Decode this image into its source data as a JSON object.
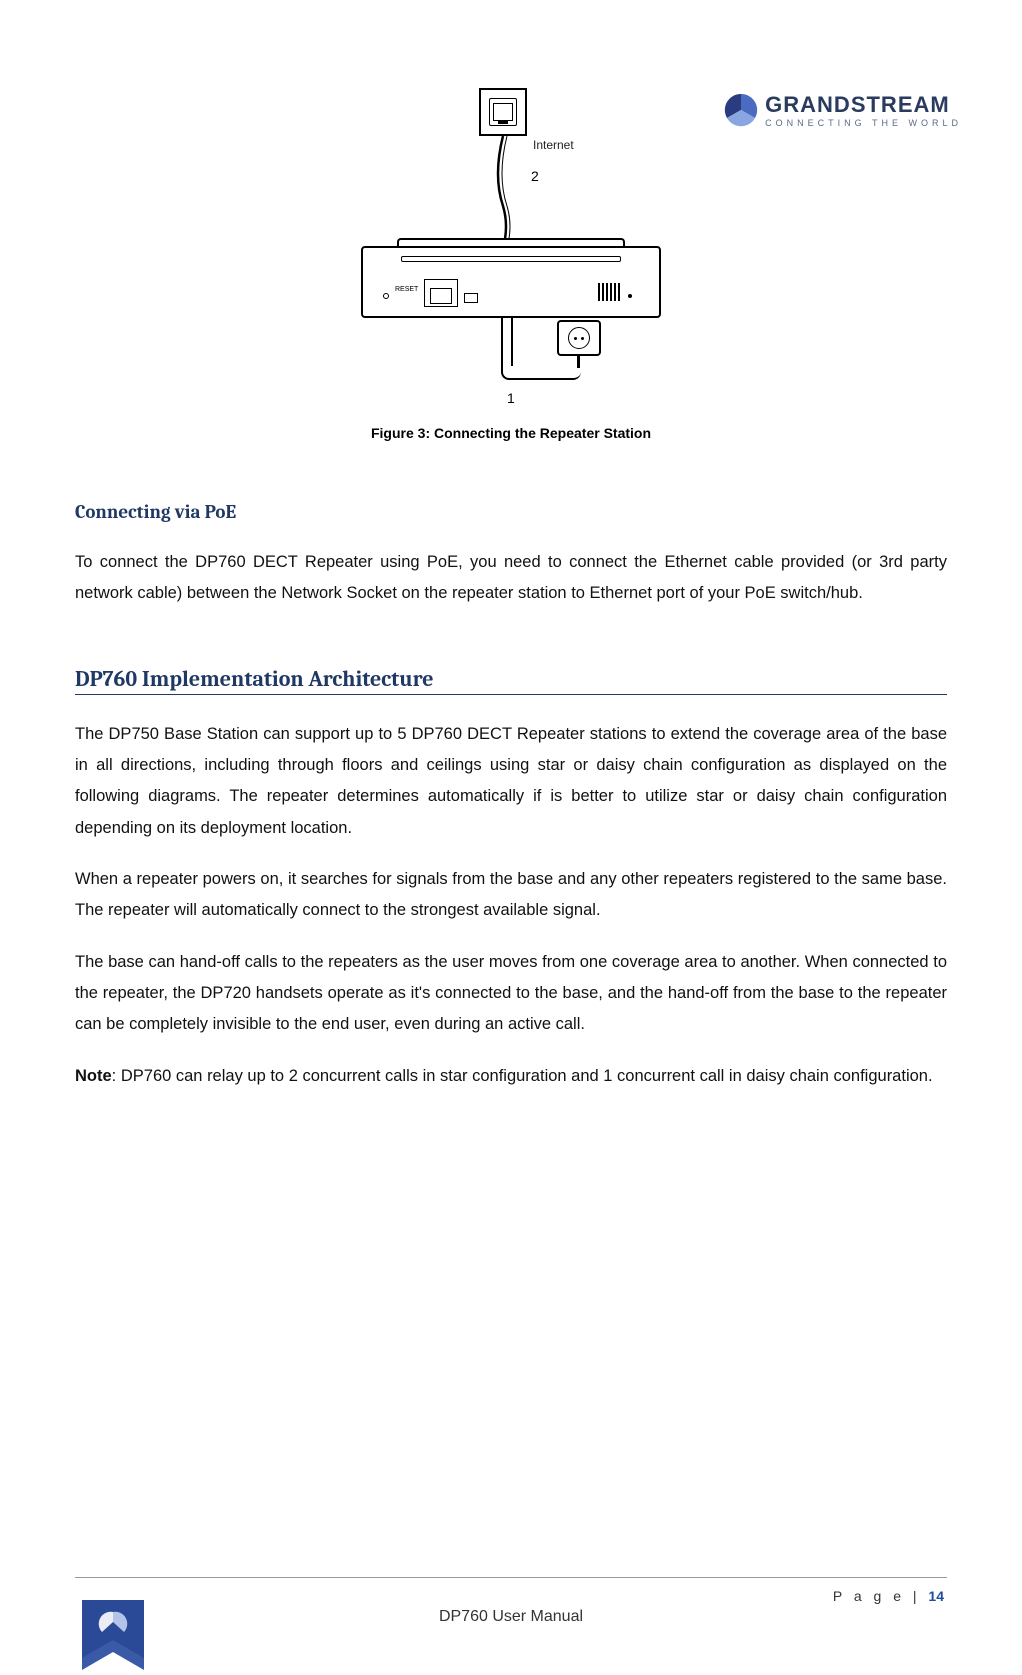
{
  "header": {
    "brand": "GRANDSTREAM",
    "tagline": "CONNECTING THE WORLD"
  },
  "figure": {
    "internet_label": "Internet",
    "label_1": "1",
    "label_2": "2",
    "reset_label": "RESET",
    "caption": "Figure 3: Connecting the Repeater Station"
  },
  "section1": {
    "heading": "Connecting via PoE",
    "p1": "To connect the DP760 DECT Repeater using PoE, you need to connect the Ethernet cable provided (or 3rd party network cable) between the Network Socket on the repeater station to Ethernet port of your PoE switch/hub."
  },
  "section2": {
    "heading": "DP760 Implementation Architecture",
    "p1": "The DP750 Base Station can support up to 5 DP760 DECT Repeater stations to extend the coverage area of the base in all directions, including through floors and ceilings using star or daisy chain configuration as displayed on the following diagrams. The repeater determines automatically if is better to utilize star or daisy chain configuration depending on its deployment location.",
    "p2": "When a repeater powers on, it searches for signals from the base and any other repeaters registered to the same base. The repeater will automatically connect to the strongest available signal.",
    "p3": "The base can hand-off calls to the repeaters as the user moves from one coverage area to another. When connected to the repeater, the DP720 handsets operate as it's connected to the base, and the hand-off from the base to the repeater can be completely invisible to the end user, even during an active call.",
    "note_label": "Note",
    "note_text": ": DP760 can relay up to 2 concurrent calls in star configuration and 1 concurrent call in daisy chain configuration."
  },
  "footer": {
    "page_label": "P a g e  | ",
    "page_number": "14",
    "doc_title": "DP760 User Manual"
  }
}
